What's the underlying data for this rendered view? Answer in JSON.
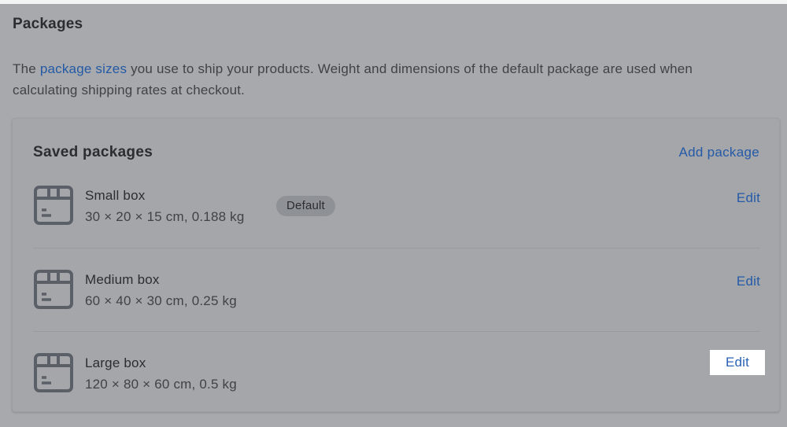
{
  "section": {
    "title": "Packages",
    "description_before": "The ",
    "description_link": "package sizes",
    "description_after": " you use to ship your products. Weight and dimensions of the default package are used when calculating shipping rates at checkout."
  },
  "card": {
    "title": "Saved packages",
    "add_label": "Add package"
  },
  "packages": [
    {
      "name": "Small box",
      "dims": "30 × 20 × 15 cm, 0.188 kg",
      "badge": "Default",
      "edit_label": "Edit",
      "icon": "package-box-icon"
    },
    {
      "name": "Medium box",
      "dims": "60 × 40 × 30 cm, 0.25 kg",
      "edit_label": "Edit",
      "icon": "package-box-icon"
    },
    {
      "name": "Large box",
      "dims": "120 × 80 × 60 cm, 0.5 kg",
      "edit_label": "Edit",
      "icon": "package-box-icon"
    }
  ],
  "colors": {
    "link": "#245aa8",
    "overlay_bg": "#a7a9ac",
    "highlight": "#ffffff"
  }
}
